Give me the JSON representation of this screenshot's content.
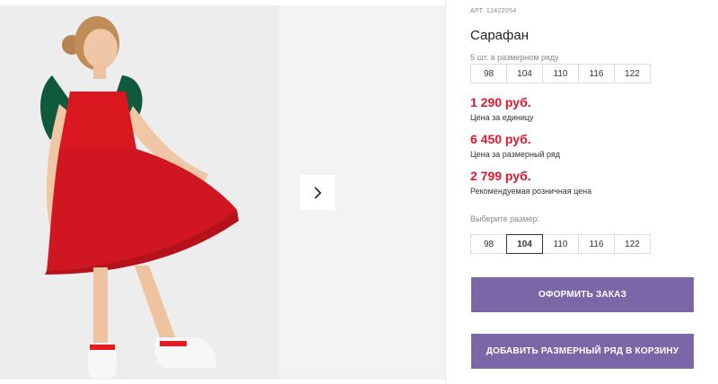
{
  "product": {
    "article": "АРТ. 12422054",
    "title": "Сарафан",
    "row_label": "5 шт. в размерном ряду",
    "row_sizes": [
      "98",
      "104",
      "110",
      "116",
      "122"
    ],
    "prices": [
      {
        "value": "1 290 руб.",
        "caption": "Цена за единицу"
      },
      {
        "value": "6 450 руб.",
        "caption": "Цена за размерный ряд"
      },
      {
        "value": "2 799 руб.",
        "caption": "Рекомендуемая розничная цена"
      }
    ],
    "choose_label": "Выберите размер:",
    "choose_sizes": [
      "98",
      "104",
      "110",
      "116",
      "122"
    ],
    "selected_size": "104"
  },
  "buttons": {
    "order": "ОФОРМИТЬ ЗАКАЗ",
    "add_row": "ДОБАВИТЬ РАЗМЕРНЫЙ РЯД В КОРЗИНУ"
  },
  "colors": {
    "price": "#e2162b",
    "button": "#7b67a8",
    "dress": "#d8171f",
    "bow": "#0f5a3c"
  },
  "icons": {
    "next": "chevron-right-icon"
  }
}
